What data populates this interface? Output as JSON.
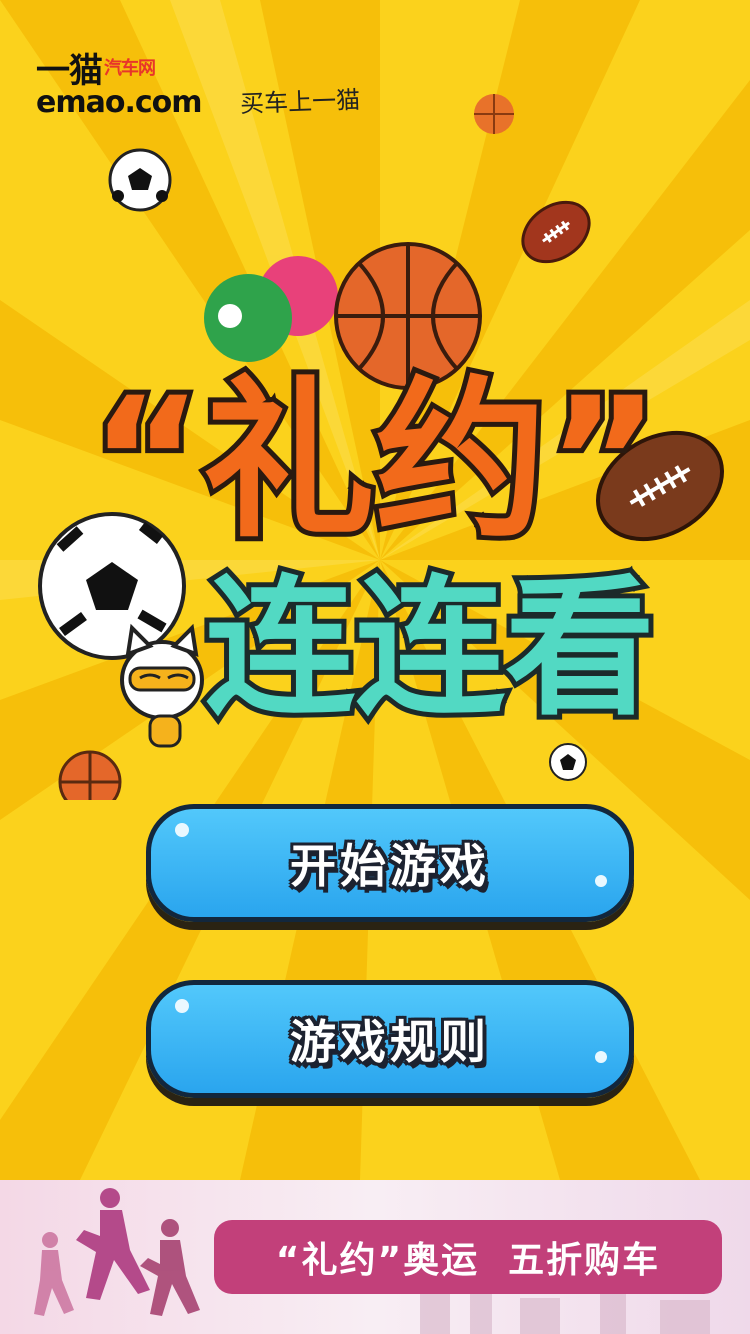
{
  "brand": {
    "logo_cn": "一猫",
    "logo_tag": "汽车网",
    "logo_url": "emao.com",
    "slogan": "买车上一猫"
  },
  "title": {
    "line1": "“礼约”",
    "line2": "连连看"
  },
  "buttons": {
    "start": "开始游戏",
    "rules": "游戏规则"
  },
  "banner": {
    "text": "“礼约”奥运  五折购车"
  },
  "colors": {
    "background": "#fbd21c",
    "ray": "#f7c20c",
    "title_orange": "#f26a1b",
    "title_teal": "#52d9c3",
    "button_blue": "#38b4f5",
    "banner_pill": "#c2407a"
  },
  "icons": [
    "soccer-ball-icon",
    "basketball-icon",
    "rugby-ball-icon",
    "ping-pong-paddle-icon",
    "mascot-cat-icon",
    "runners-silhouette-icon"
  ]
}
